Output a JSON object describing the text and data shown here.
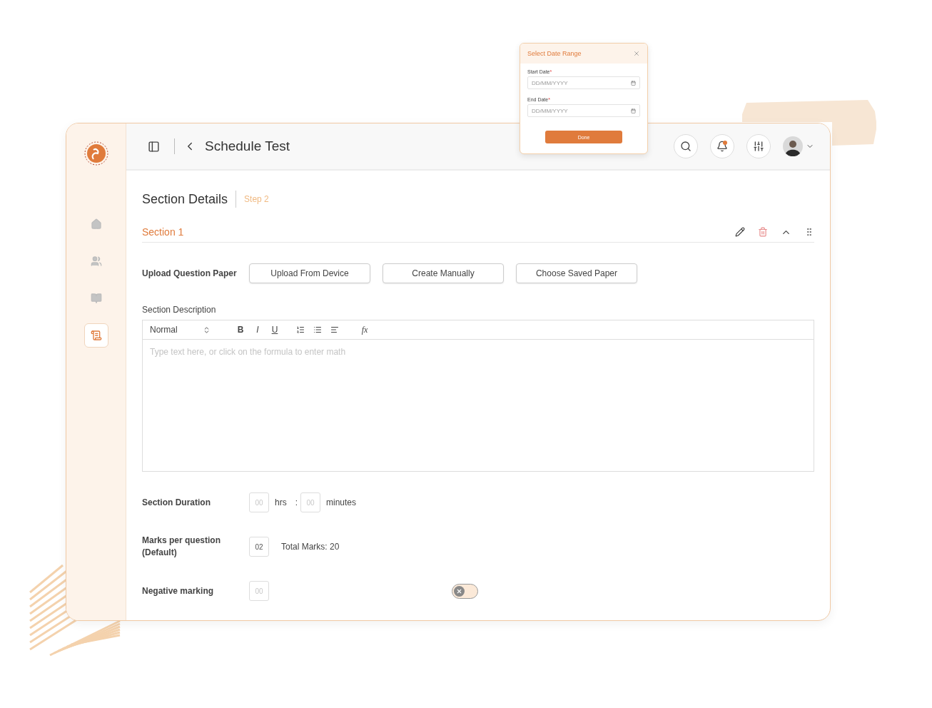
{
  "sidebar": {
    "items": [
      {
        "kind": "home",
        "selected": false
      },
      {
        "kind": "users",
        "selected": false
      },
      {
        "kind": "book",
        "selected": false
      },
      {
        "kind": "scroll",
        "selected": true
      }
    ]
  },
  "header": {
    "title": "Schedule Test",
    "notification_dot": true
  },
  "page": {
    "title": "Section Details",
    "step": "Step 2"
  },
  "section": {
    "title": "Section 1",
    "expanded": true
  },
  "upload": {
    "label": "Upload Question Paper",
    "buttons": [
      "Upload From Device",
      "Create Manually",
      "Choose Saved Paper"
    ]
  },
  "description": {
    "label": "Section Description",
    "format": "Normal",
    "toolbar": [
      {
        "kind": "bold",
        "label": "B"
      },
      {
        "kind": "italic",
        "label": "I"
      },
      {
        "kind": "underline",
        "label": "U"
      },
      {
        "kind": "ordered-list"
      },
      {
        "kind": "bullet-list"
      },
      {
        "kind": "align"
      },
      {
        "kind": "formula",
        "label": "fx"
      }
    ],
    "placeholder": "Type text here, or click on the formula to enter math"
  },
  "duration": {
    "label": "Section Duration",
    "hours_placeholder": "00",
    "hours_unit": "hrs",
    "separator": ":",
    "minutes_placeholder": "00",
    "minutes_unit": "minutes"
  },
  "marks": {
    "label": "Marks per question (Default)",
    "value": "02",
    "total": "Total Marks: 20"
  },
  "negative": {
    "label": "Negative marking",
    "placeholder": "00",
    "on": false
  },
  "popup": {
    "title": "Select Date Range",
    "fields": [
      {
        "label": "Start Date",
        "required_mark": "*",
        "placeholder": "DD/MM/YYYY"
      },
      {
        "label": "End Date",
        "required_mark": "*",
        "placeholder": "DD/MM/YYYY"
      }
    ],
    "button": "Done"
  }
}
